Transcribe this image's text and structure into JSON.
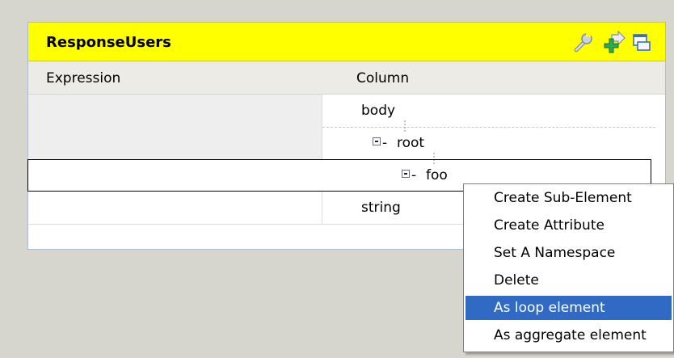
{
  "panel": {
    "title": "ResponseUsers",
    "toolbar_icons": [
      "wrench-icon",
      "import-arrow-icon",
      "window-icon"
    ]
  },
  "headers": {
    "expression": "Expression",
    "column": "Column"
  },
  "rows": [
    {
      "expression": "",
      "column": "body"
    },
    {
      "expression": "",
      "column": "root"
    },
    {
      "expression": "",
      "column": "foo",
      "selected": true
    },
    {
      "expression": "",
      "column": "string"
    }
  ],
  "context_menu": {
    "items": [
      "Create Sub-Element",
      "Create Attribute",
      "Set A Namespace",
      "Delete",
      "As loop element",
      "As aggregate element"
    ],
    "highlighted": "As loop element"
  },
  "colors": {
    "title_bar": "#ffff00",
    "selection": "#316ac5",
    "background": "#d7d6ce"
  }
}
